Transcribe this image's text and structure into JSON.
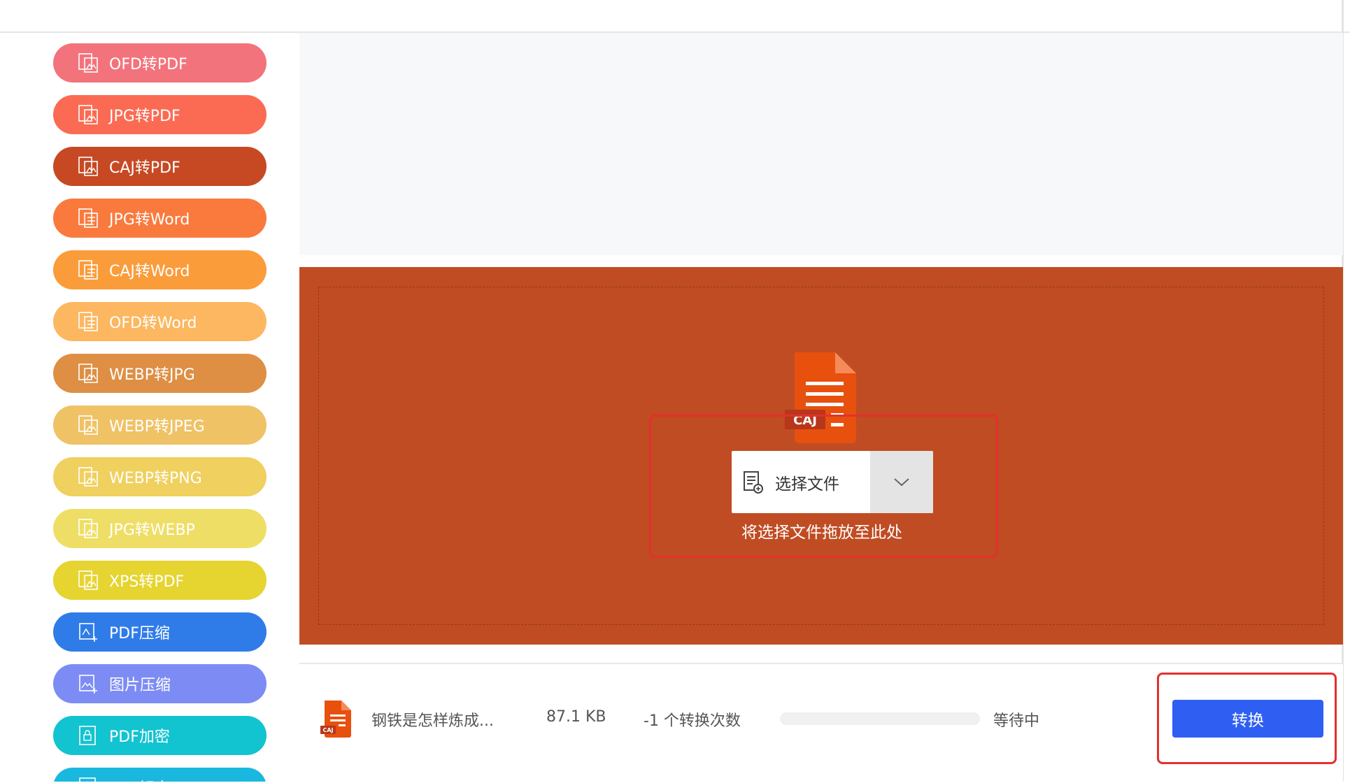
{
  "colors": {
    "drop_zone_bg": "#c04c23",
    "accent_orange": "#e8500e",
    "convert_button": "#2f5ff2",
    "highlight_red": "#e4302e"
  },
  "sidebar": {
    "items": [
      {
        "label": "OFD转PDF",
        "color": "#f3737c",
        "icon": "ofd-to-pdf-icon"
      },
      {
        "label": "JPG转PDF",
        "color": "#fb6b53",
        "icon": "jpg-to-pdf-icon"
      },
      {
        "label": "CAJ转PDF",
        "color": "#c64924",
        "icon": "caj-to-pdf-icon"
      },
      {
        "label": "JPG转Word",
        "color": "#fa7a3e",
        "icon": "jpg-to-word-icon"
      },
      {
        "label": "CAJ转Word",
        "color": "#fb9c3a",
        "icon": "caj-to-word-icon"
      },
      {
        "label": "OFD转Word",
        "color": "#fcb760",
        "icon": "ofd-to-word-icon"
      },
      {
        "label": "WEBP转JPG",
        "color": "#de8f44",
        "icon": "webp-to-jpg-icon"
      },
      {
        "label": "WEBP转JPEG",
        "color": "#efc266",
        "icon": "webp-to-jpeg-icon"
      },
      {
        "label": "WEBP转PNG",
        "color": "#f0d05e",
        "icon": "webp-to-png-icon"
      },
      {
        "label": "JPG转WEBP",
        "color": "#efde66",
        "icon": "jpg-to-webp-icon"
      },
      {
        "label": "XPS转PDF",
        "color": "#e6d431",
        "icon": "xps-to-pdf-icon"
      },
      {
        "label": "PDF压缩",
        "color": "#2f7ce9",
        "icon": "pdf-compress-icon"
      },
      {
        "label": "图片压缩",
        "color": "#7d8cf4",
        "icon": "image-compress-icon"
      },
      {
        "label": "PDF加密",
        "color": "#12c3d0",
        "icon": "pdf-encrypt-icon"
      },
      {
        "label": "PDF解密",
        "color": "#1ab8df",
        "icon": "pdf-decrypt-icon"
      }
    ]
  },
  "upload": {
    "file_badge": "CAJ",
    "select_button_label": "选择文件",
    "drop_hint": "将选择文件拖放至此处"
  },
  "file_row": {
    "file_badge": "CAJ",
    "name": "钢铁是怎样炼成...",
    "size": "87.1 KB",
    "count": "-1 个转换次数",
    "progress": 0,
    "status": "等待中",
    "convert_label": "转换"
  }
}
